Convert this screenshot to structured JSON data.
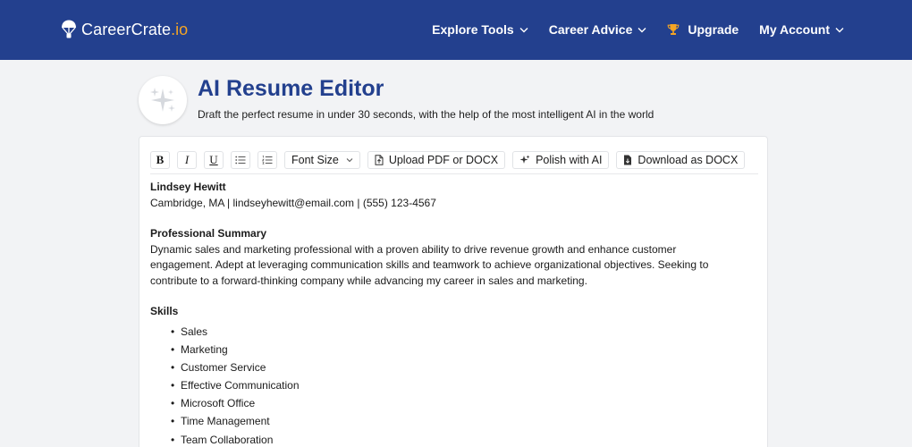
{
  "brand": {
    "name": "CareerCrate",
    "tld": ".io",
    "accent": "#f5a524",
    "navbar_color": "#23408e"
  },
  "nav": {
    "explore_tools": "Explore Tools",
    "career_advice": "Career Advice",
    "upgrade": "Upgrade",
    "my_account": "My Account"
  },
  "header": {
    "title": "AI Resume Editor",
    "subtitle": "Draft the perfect resume in under 30 seconds, with the help of the most intelligent AI in the world",
    "emblem_icon": "sparkles-icon"
  },
  "toolbar": {
    "bold": "B",
    "italic": "I",
    "underline": "U",
    "bullet_list_icon": "bullet-list-icon",
    "numbered_list_icon": "numbered-list-icon",
    "font_size": "Font Size",
    "upload": "Upload PDF or DOCX",
    "polish": "Polish with AI",
    "download": "Download as DOCX"
  },
  "resume": {
    "name": "Lindsey Hewitt",
    "contact": "Cambridge, MA | lindseyhewitt@email.com | (555) 123-4567",
    "summary_heading": "Professional Summary",
    "summary_text": "Dynamic sales and marketing professional with a proven ability to drive revenue growth and enhance customer engagement. Adept at leveraging communication skills and teamwork to achieve organizational objectives. Seeking to contribute to a forward-thinking company while advancing my career in sales and marketing.",
    "skills_heading": "Skills",
    "skills": [
      "Sales",
      "Marketing",
      "Customer Service",
      "Effective Communication",
      "Microsoft Office",
      "Time Management",
      "Team Collaboration"
    ]
  }
}
